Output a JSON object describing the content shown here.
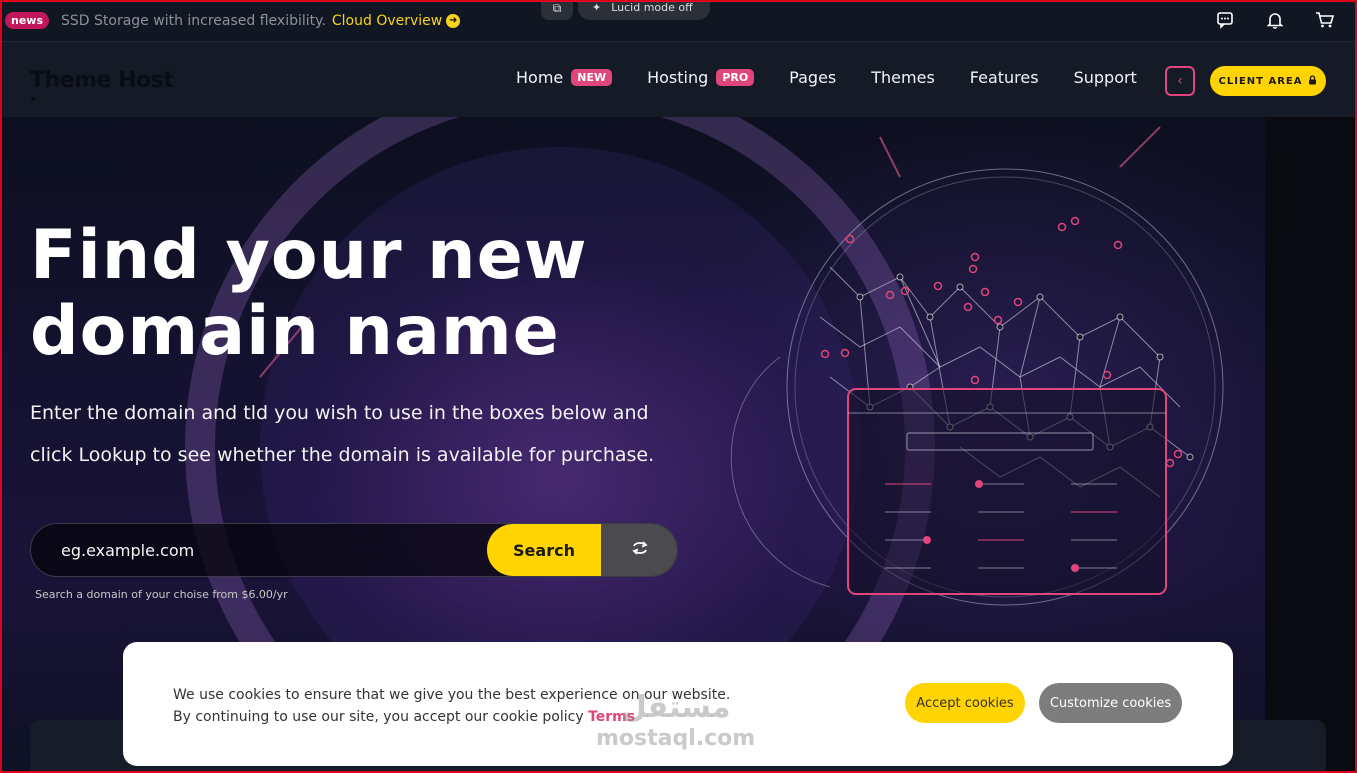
{
  "topbar": {
    "badge": "news",
    "text": "SSD Storage with increased flexibility.",
    "link": "Cloud Overview",
    "ext_label": "Lucid mode off",
    "icons": [
      "chat-icon",
      "bell-icon",
      "cart-icon"
    ]
  },
  "nav": {
    "logo": "Theme Host",
    "items": [
      {
        "label": "Home",
        "tag": "NEW"
      },
      {
        "label": "Hosting",
        "tag": "PRO"
      },
      {
        "label": "Pages"
      },
      {
        "label": "Themes"
      },
      {
        "label": "Features"
      },
      {
        "label": "Support"
      }
    ],
    "client_area": "CLIENT AREA"
  },
  "hero": {
    "headline_line1": "Find your new",
    "headline_line2": "domain name",
    "sub_line1": "Enter the domain and tld you wish to use in the boxes below and",
    "sub_line2": "click Lookup to see whether the domain is available for purchase.",
    "search": {
      "placeholder": "eg.example.com",
      "button": "Search",
      "note": "Search a domain of your choise from $6.00/yr"
    }
  },
  "cookie": {
    "line1": "We use cookies to ensure that we give you the best experience on our website.",
    "line2": "By continuing to use our site, you accept our cookie policy",
    "terms": "Terms",
    "accept": "Accept cookies",
    "customize": "Customize cookies"
  },
  "watermark": {
    "arabic": "مستقل",
    "latin": "mostaql.com"
  },
  "colors": {
    "accent_yellow": "#ffd400",
    "accent_pink": "#e0457b",
    "nav_bg": "#141b26"
  }
}
